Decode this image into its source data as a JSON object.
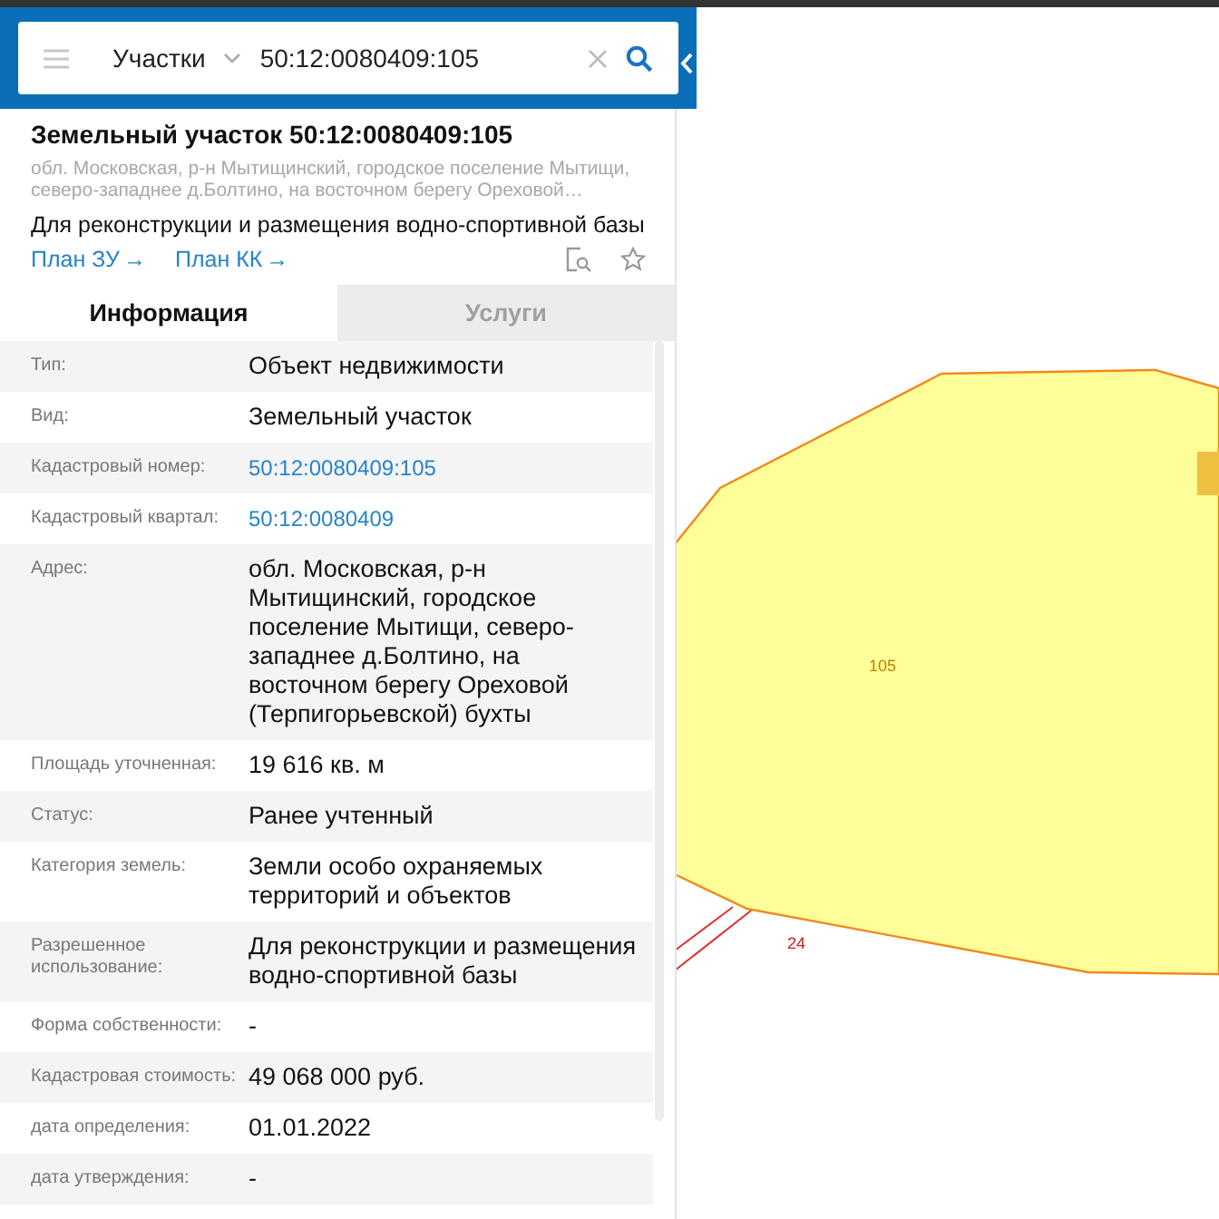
{
  "search": {
    "category": "Участки",
    "value": "50:12:0080409:105"
  },
  "result": {
    "title": "Земельный участок 50:12:0080409:105",
    "address": "обл. Московская, р-н Мытищинский, городское поселение Мытищи, северо-западнее д.Болтино, на восточном берегу Ореховой…",
    "purpose": "Для реконструкции и размещения водно-спортивной базы",
    "links": [
      {
        "label": "План ЗУ",
        "arrow": "→"
      },
      {
        "label": "План КК",
        "arrow": "→"
      }
    ]
  },
  "tabs": [
    {
      "label": "Информация",
      "selected": true
    },
    {
      "label": "Услуги",
      "selected": false
    }
  ],
  "rows": [
    {
      "label": "Тип:",
      "value": "Объект недвижимости",
      "kind": "text"
    },
    {
      "label": "Вид:",
      "value": "Земельный участок",
      "kind": "text"
    },
    {
      "label": "Кадастровый номер:",
      "value": "50:12:0080409:105",
      "kind": "link"
    },
    {
      "label": "Кадастровый квартал:",
      "value": "50:12:0080409",
      "kind": "link"
    },
    {
      "label": "Адрес:",
      "value": "обл. Московская, р-н Мытищинский, городское поселение Мытищи, северо-западнее д.Болтино, на восточном берегу Ореховой (Терпигорьевской) бухты",
      "kind": "text"
    },
    {
      "label": "Площадь уточненная:",
      "value": "19 616 кв. м",
      "kind": "text"
    },
    {
      "label": "Статус:",
      "value": "Ранее учтенный",
      "kind": "text"
    },
    {
      "label": "Категория земель:",
      "value": "Земли особо охраняемых территорий и объектов",
      "kind": "text"
    },
    {
      "label": "Разрешенное использование:",
      "value": "Для реконструкции и размещения водно-спортивной базы",
      "kind": "text"
    },
    {
      "label": "Форма собственности:",
      "value": "-",
      "kind": "text"
    },
    {
      "label": "Кадастровая стоимость:",
      "value": "49 068 000 руб.",
      "kind": "text"
    },
    {
      "label": "дата определения:",
      "value": "01.01.2022",
      "kind": "text"
    },
    {
      "label": "дата утверждения:",
      "value": "-",
      "kind": "text"
    }
  ],
  "map": {
    "parcel_label": "105",
    "neighbor_label": "24"
  }
}
